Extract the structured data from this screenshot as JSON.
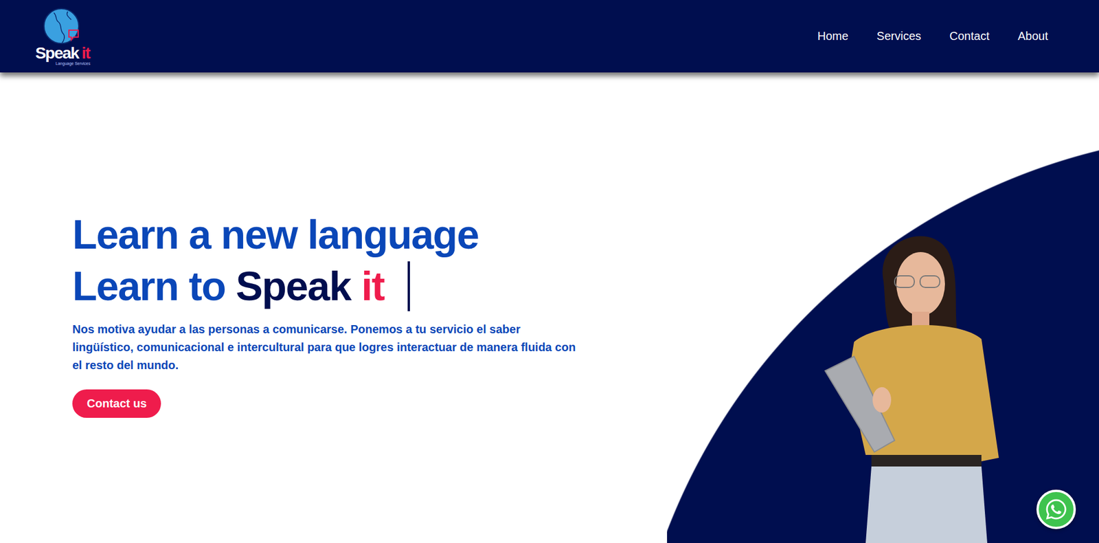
{
  "header": {
    "logo": {
      "name_main": "Speak",
      "name_accent": "it",
      "tagline": "Language Services"
    },
    "nav": [
      {
        "label": "Home",
        "selected": false
      },
      {
        "label": "Services",
        "selected": false
      },
      {
        "label": "Contact",
        "selected": false
      },
      {
        "label": "About",
        "selected": false
      }
    ]
  },
  "hero": {
    "title_line1": "Learn a new language",
    "title_line2_prefix": "Learn to",
    "title_brand_main": "Speak",
    "title_brand_accent": "it",
    "cursor_visible": true,
    "description": "Nos motiva ayudar a las personas a comunicarse. Ponemos a tu servicio el saber lingüístico, comunicacional e intercultural para que logres interactuar de manera fluida con el resto del mundo.",
    "button": "Contact us"
  }
}
